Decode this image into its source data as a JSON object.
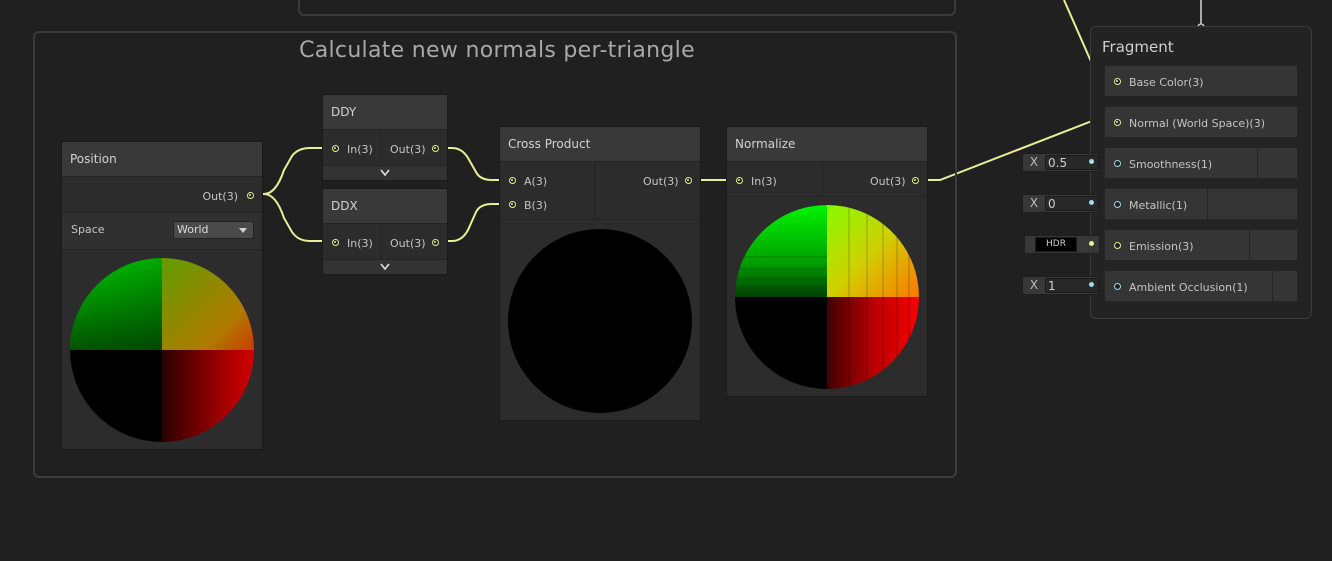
{
  "group": {
    "title": "Calculate new normals per-triangle"
  },
  "nodes": {
    "position": {
      "title": "Position",
      "out_label": "Out(3)",
      "space_label": "Space",
      "space_value": "World"
    },
    "ddy": {
      "title": "DDY",
      "in_label": "In(3)",
      "out_label": "Out(3)",
      "expand_icon": "chevron-down"
    },
    "ddx": {
      "title": "DDX",
      "in_label": "In(3)",
      "out_label": "Out(3)",
      "expand_icon": "chevron-down"
    },
    "cross": {
      "title": "Cross Product",
      "in_a": "A(3)",
      "in_b": "B(3)",
      "out_label": "Out(3)"
    },
    "normalize": {
      "title": "Normalize",
      "in_label": "In(3)",
      "out_label": "Out(3)"
    }
  },
  "fragment": {
    "title": "Fragment",
    "ports": [
      {
        "label": "Base Color(3)"
      },
      {
        "label": "Normal (World Space)(3)"
      },
      {
        "label": "Smoothness(1)",
        "input_prefix": "X",
        "input_value": "0.5"
      },
      {
        "label": "Metallic(1)",
        "input_prefix": "X",
        "input_value": "0"
      },
      {
        "label": "Emission(3)",
        "input_value": "HDR"
      },
      {
        "label": "Ambient Occlusion(1)",
        "input_prefix": "X",
        "input_value": "1"
      }
    ]
  },
  "colors": {
    "background": "#202020",
    "wire_vec3": "#e6ef95",
    "wire_float": "#9fd8e6",
    "node_body": "#2c2c2c",
    "node_header": "#393939"
  }
}
